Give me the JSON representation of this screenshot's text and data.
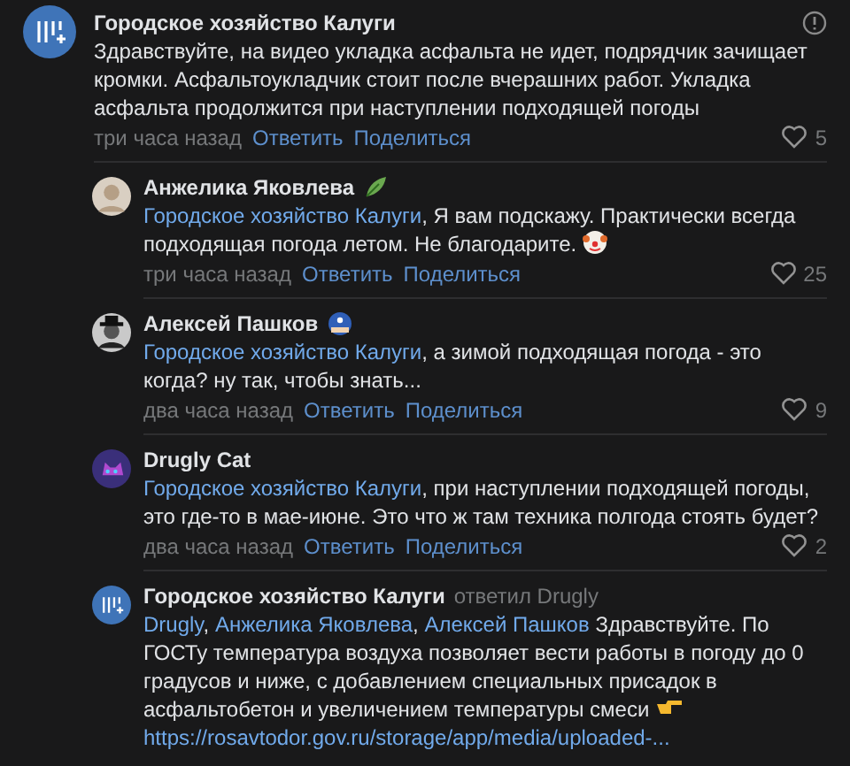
{
  "comments": [
    {
      "kind": "top",
      "author": "Городское хозяйство Калуги",
      "report": true,
      "body": [
        {
          "kind": "text",
          "text": "Здравствуйте, на видео укладка асфальта не идет, подрядчик зачищает кромки. Асфальтоукладчик стоит после вчерашних работ. Укладка асфальта продолжится при наступлении подходящей погоды"
        }
      ],
      "time": "три часа назад",
      "reply": "Ответить",
      "share": "Поделиться",
      "likes": "5"
    },
    {
      "kind": "reply",
      "author": "Анжелика Яковлева",
      "body": [
        {
          "kind": "mention",
          "text": "Городское хозяйство Калуги"
        },
        {
          "kind": "text",
          "text": ", Я вам подскажу. Практически всегда подходящая погода летом. Не благодарите. "
        },
        {
          "kind": "emoji"
        }
      ],
      "time": "три часа назад",
      "reply": "Ответить",
      "share": "Поделиться",
      "likes": "25"
    },
    {
      "kind": "reply",
      "author": "Алексей Пашков",
      "body": [
        {
          "kind": "mention",
          "text": "Городское хозяйство Калуги"
        },
        {
          "kind": "text",
          "text": ", а зимой подходящая погода - это когда? ну так, чтобы знать..."
        }
      ],
      "time": "два часа назад",
      "reply": "Ответить",
      "share": "Поделиться",
      "likes": "9"
    },
    {
      "kind": "reply",
      "author": "Drugly Cat",
      "body": [
        {
          "kind": "mention",
          "text": "Городское хозяйство Калуги"
        },
        {
          "kind": "text",
          "text": ", при наступлении подходящей погоды, это где-то в мае-июне. Это что ж там техника полгода стоять будет?"
        }
      ],
      "time": "два часа назад",
      "reply": "Ответить",
      "share": "Поделиться",
      "likes": "2"
    },
    {
      "kind": "reply",
      "author": "Городское хозяйство Калуги",
      "replied_to": "ответил Drugly",
      "body": [
        {
          "kind": "mention",
          "text": "Drugly"
        },
        {
          "kind": "text",
          "text": ", "
        },
        {
          "kind": "mention",
          "text": "Анжелика Яковлева"
        },
        {
          "kind": "text",
          "text": ", "
        },
        {
          "kind": "mention",
          "text": "Алексей Пашков"
        },
        {
          "kind": "text",
          "text": " Здравствуйте. По ГОСТу температура воздуха позволяет вести работы в погоду до 0 градусов и ниже, с добавлением специальных присадок в асфальтобетон и увеличением температуры смеси "
        },
        {
          "kind": "emoji"
        },
        {
          "kind": "link",
          "text": "https://rosavtodor.gov.ru/storage/app/media/uploaded-..."
        }
      ]
    }
  ]
}
